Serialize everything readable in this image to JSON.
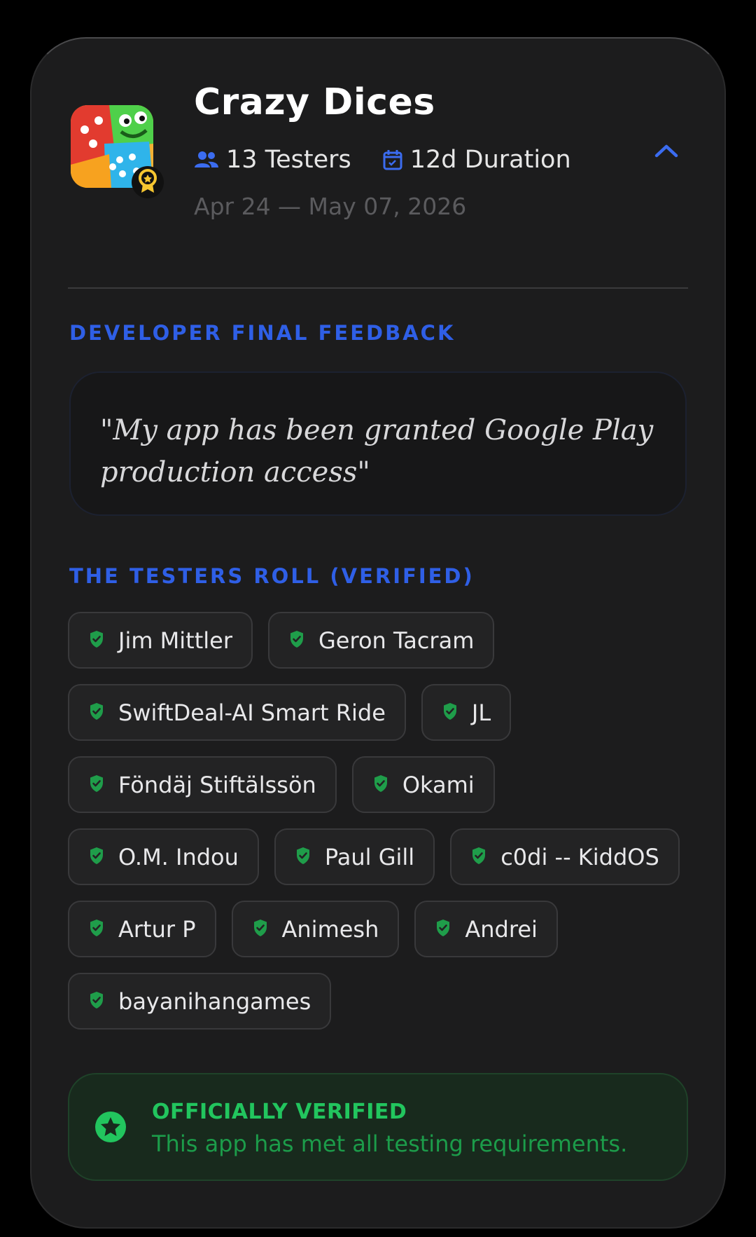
{
  "app": {
    "title": "Crazy Dices",
    "icon": "dice-game-app-icon",
    "badge_icon": "award-ribbon-icon"
  },
  "meta": {
    "testers_label": "13 Testers",
    "duration_label": "12d Duration",
    "date_range": "Apr 24 — May 07, 2026"
  },
  "feedback": {
    "section_label": "DEVELOPER FINAL FEEDBACK",
    "quote": "\"My app has been granted Google Play production access\""
  },
  "testers": {
    "section_label": "THE TESTERS ROLL (VERIFIED)",
    "rows": [
      [
        "Jim Mittler",
        "Geron Tacram"
      ],
      [
        "SwiftDeal-AI Smart Ride",
        "JL"
      ],
      [
        "Föndäj Stiftälssön",
        "Okami"
      ],
      [
        "O.M. Indou",
        "Paul Gill",
        "c0di -- KiddOS"
      ],
      [
        "Artur P",
        "Animesh",
        "Andrei"
      ],
      [
        "bayanihangames"
      ]
    ]
  },
  "verification": {
    "title": "OFFICIALLY VERIFIED",
    "subtitle": "This app has met all testing requirements."
  },
  "colors": {
    "accent_blue": "#2f5fe6",
    "verified_green": "#22c55e",
    "shield_green": "#1f9d4a"
  }
}
